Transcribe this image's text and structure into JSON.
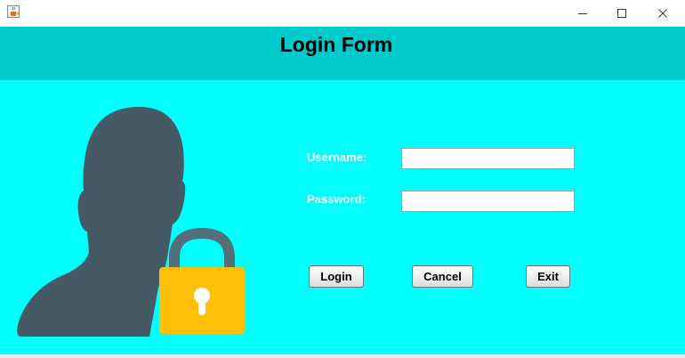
{
  "window": {
    "icon": "java-coffee-cup-icon",
    "controls": {
      "minimize": "minimize-icon",
      "maximize": "maximize-icon",
      "close": "close-icon"
    }
  },
  "header": {
    "title": "Login Form",
    "color": "#00c9c9"
  },
  "form": {
    "background": "#00ffff",
    "username_label": "Username:",
    "username_value": "",
    "password_label": "Password:",
    "password_value": ""
  },
  "buttons": {
    "login": "Login",
    "cancel": "Cancel",
    "exit": "Exit"
  },
  "illustration": {
    "icon": "user-lock-icon",
    "silhouette_color": "#455a64",
    "lock_color": "#ffc107"
  }
}
